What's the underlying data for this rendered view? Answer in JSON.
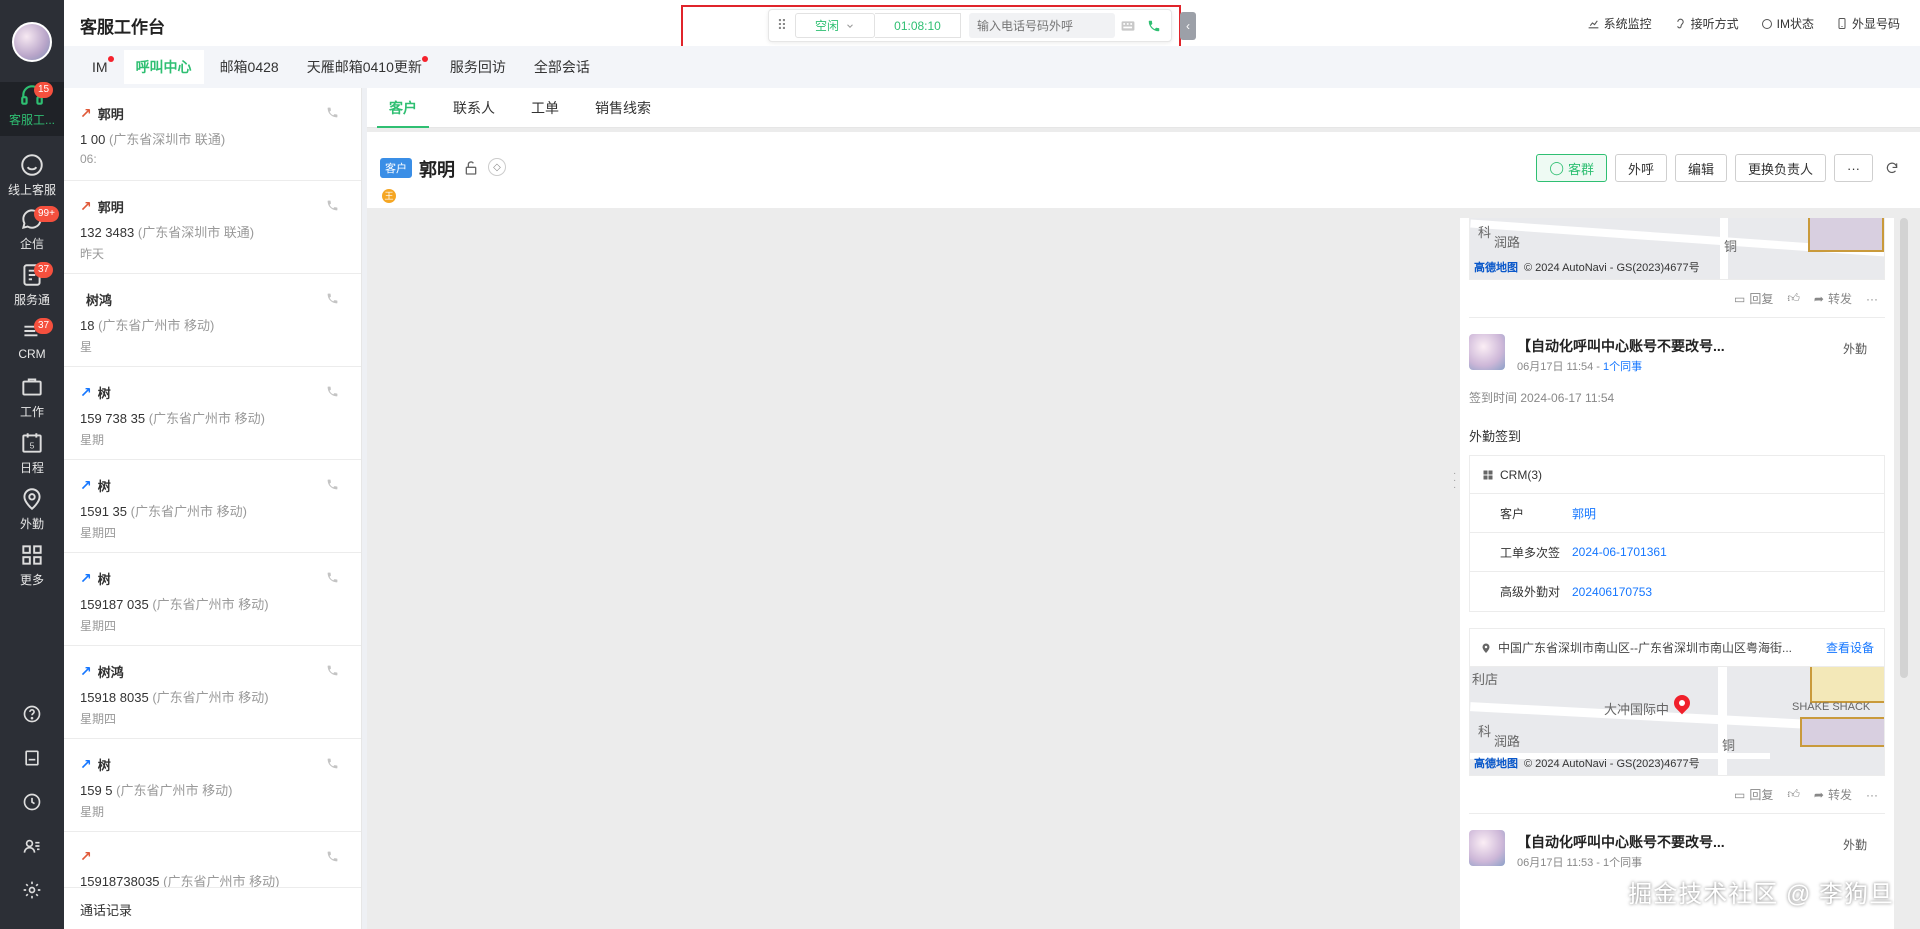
{
  "app": {
    "title": "客服工作台"
  },
  "leftnav": {
    "items": [
      {
        "label": "客服工...",
        "badge": "15",
        "icon": "headset-icon"
      },
      {
        "label": "线上客服",
        "badge": "",
        "icon": "smile-chat-icon"
      },
      {
        "label": "企信",
        "badge": "99+",
        "icon": "chat-bubble-icon"
      },
      {
        "label": "服务通",
        "badge": "37",
        "icon": "service-icon"
      },
      {
        "label": "CRM",
        "badge": "37",
        "icon": "crm-icon"
      },
      {
        "label": "工作",
        "badge": "",
        "icon": "work-icon"
      },
      {
        "label": "日程",
        "badge": "",
        "icon": "calendar-icon"
      },
      {
        "label": "外勤",
        "badge": "",
        "icon": "location-icon"
      },
      {
        "label": "更多",
        "badge": "",
        "icon": "grid-icon"
      }
    ],
    "calendar_day": "5",
    "bottom_icons": [
      "help-icon",
      "note-icon",
      "history-icon",
      "contacts-icon",
      "settings-icon"
    ]
  },
  "callbar": {
    "status": "空闲",
    "timer": "01:08:10",
    "dial_placeholder": "输入电话号码外呼"
  },
  "topright": {
    "monitor": "系统监控",
    "answer_mode": "接听方式",
    "im_status": "IM状态",
    "display_number": "外显号码"
  },
  "tabs": [
    {
      "label": "IM",
      "dot": true
    },
    {
      "label": "呼叫中心",
      "dot": false,
      "active": true
    },
    {
      "label": "邮箱0428",
      "dot": false
    },
    {
      "label": "天雁邮箱0410更新",
      "dot": true
    },
    {
      "label": "服务回访",
      "dot": false
    },
    {
      "label": "全部会话",
      "dot": false
    }
  ],
  "calls": [
    {
      "name": "郭明",
      "number": "1        00",
      "location": "(广东省深圳市 联通)",
      "time": "06:",
      "dir": "out"
    },
    {
      "name": "郭明",
      "number": "132    3483",
      "location": "(广东省深圳市 联通)",
      "time": "昨天",
      "dir": "out"
    },
    {
      "name": "树鸿",
      "number": "   18",
      "location": "(广东省广州市 移动)",
      "time": "星",
      "dir": "none"
    },
    {
      "name": "树",
      "number": "159   738  35",
      "location": "(广东省广州市 移动)",
      "time": "星期",
      "dir": "in"
    },
    {
      "name": "树",
      "number": "1591     35",
      "location": "(广东省广州市 移动)",
      "time": "星期四",
      "dir": "in"
    },
    {
      "name": "树",
      "number": "159187   035",
      "location": "(广东省广州市 移动)",
      "time": "星期四",
      "dir": "in"
    },
    {
      "name": "树鸿",
      "number": "15918  8035",
      "location": "(广东省广州市 移动)",
      "time": "星期四",
      "dir": "in"
    },
    {
      "name": "树",
      "number": "159     5",
      "location": "(广东省广州市 移动)",
      "time": "星期",
      "dir": "in"
    },
    {
      "name": "",
      "number": "15918738035",
      "location": "(广东省广州市 移动)",
      "time": "",
      "dir": "out"
    }
  ],
  "calllist_footer": "通话记录",
  "subtabs": [
    "客户",
    "联系人",
    "工单",
    "销售线索"
  ],
  "customer": {
    "tag": "客户",
    "name": "郭明",
    "owner_initial": "王",
    "actions": {
      "group": "客群",
      "call": "外呼",
      "edit": "编辑",
      "change_owner": "更换负责人",
      "more": "···"
    }
  },
  "feed": {
    "map_brand": "高德地图",
    "map_copyright": "© 2024 AutoNavi - GS(2023)4677号",
    "map1_labels": [
      "科",
      "润路",
      "铜"
    ],
    "reply": "回复",
    "forward": "转发",
    "more": "···",
    "post": {
      "title": "【自动化呼叫中心账号不要改号...",
      "date": "06月17日 11:54 - ",
      "colleague": "1个同事",
      "type": "外勤",
      "checkin_time": "签到时间 2024-06-17 11:54",
      "heading": "外勤签到",
      "crm_title": "CRM(3)",
      "crm_rows": [
        {
          "k": "客户",
          "v": "郭明"
        },
        {
          "k": "工单多次签...",
          "v": "2024-06-1701361"
        },
        {
          "k": "高级外勤对象",
          "v": "202406170753"
        }
      ],
      "location": "中国广东省深圳市南山区--广东省深圳市南山区粤海街...",
      "view_device": "查看设备"
    },
    "map2_labels": [
      "利店",
      "大冲国际中",
      "SHAKE SHACK",
      "科",
      "润路",
      "铜"
    ],
    "post2": {
      "title": "【自动化呼叫中心账号不要改号...",
      "date": "06月17日 11:53 - 1个同事",
      "type": "外勤"
    }
  },
  "watermark": "掘金技术社区 @ 李狗旦"
}
